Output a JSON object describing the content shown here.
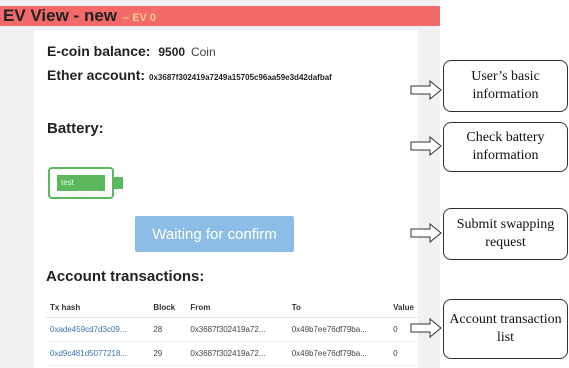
{
  "app": {
    "title": "EV View - new",
    "version": "– EV 0"
  },
  "account": {
    "balance_label": "E-coin balance:",
    "balance_value": "9500",
    "balance_unit": "Coin",
    "ether_label": "Ether account:",
    "ether_value": "0x3687f302419a7249a15705c96aa59e3d42dafbaf"
  },
  "battery": {
    "heading": "Battery:",
    "label": "test",
    "level_fraction": 0.8,
    "color": "#5cb85c"
  },
  "confirm_button": {
    "label": "Waiting for confirm",
    "color": "#8bbde6"
  },
  "transactions": {
    "heading": "Account transactions:",
    "columns": [
      "Tx hash",
      "Block",
      "From",
      "To",
      "Value"
    ],
    "rows": [
      [
        "0xade459cd7d3c09...",
        "28",
        "0x3687f302419a72...",
        "0x49b7ee76df79ba...",
        "0"
      ],
      [
        "0xd9c481d5077218...",
        "29",
        "0x3687f302419a72...",
        "0x49b7ee76df79ba...",
        "0"
      ]
    ]
  },
  "annotations": [
    "User’s basic information",
    "Check battery information",
    "Submit swapping request",
    "Account transaction list"
  ],
  "colors": {
    "titlebar": "#f26a6a",
    "link": "#3a72b0"
  }
}
